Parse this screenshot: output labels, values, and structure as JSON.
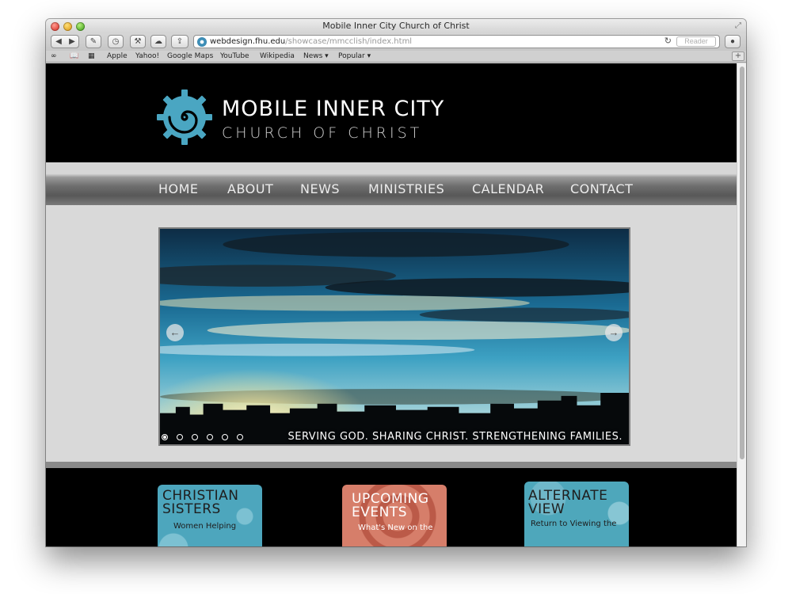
{
  "window": {
    "title": "Mobile Inner City Church of Christ"
  },
  "toolbar": {
    "url_host": "webdesign.fhu.edu",
    "url_path": "/showcase/mmcclish/index.html",
    "reader_label": "Reader"
  },
  "bookmarks": {
    "items": [
      "Apple",
      "Yahoo!",
      "Google Maps",
      "YouTube",
      "Wikipedia",
      "News ▾",
      "Popular ▾"
    ]
  },
  "site": {
    "logo_title": "MOBILE INNER CITY",
    "logo_subtitle": "CHURCH OF CHRIST",
    "accent_color": "#4aa6c2"
  },
  "nav": {
    "items": [
      "HOME",
      "ABOUT",
      "NEWS",
      "MINISTRIES",
      "CALENDAR",
      "CONTACT"
    ]
  },
  "slider": {
    "tagline": "SERVING GOD. SHARING CHRIST. STRENGTHENING FAMILIES.",
    "slide_count": 6,
    "active_slide": 1
  },
  "tiles": [
    {
      "title_line1": "CHRISTIAN",
      "title_line2": "SISTERS",
      "subtitle": "Women Helping"
    },
    {
      "title_line1": "UPCOMING",
      "title_line2": "EVENTS",
      "subtitle": "What's New on the"
    },
    {
      "title_line1": "ALTERNATE",
      "title_line2": "VIEW",
      "subtitle": "Return to Viewing the"
    }
  ]
}
